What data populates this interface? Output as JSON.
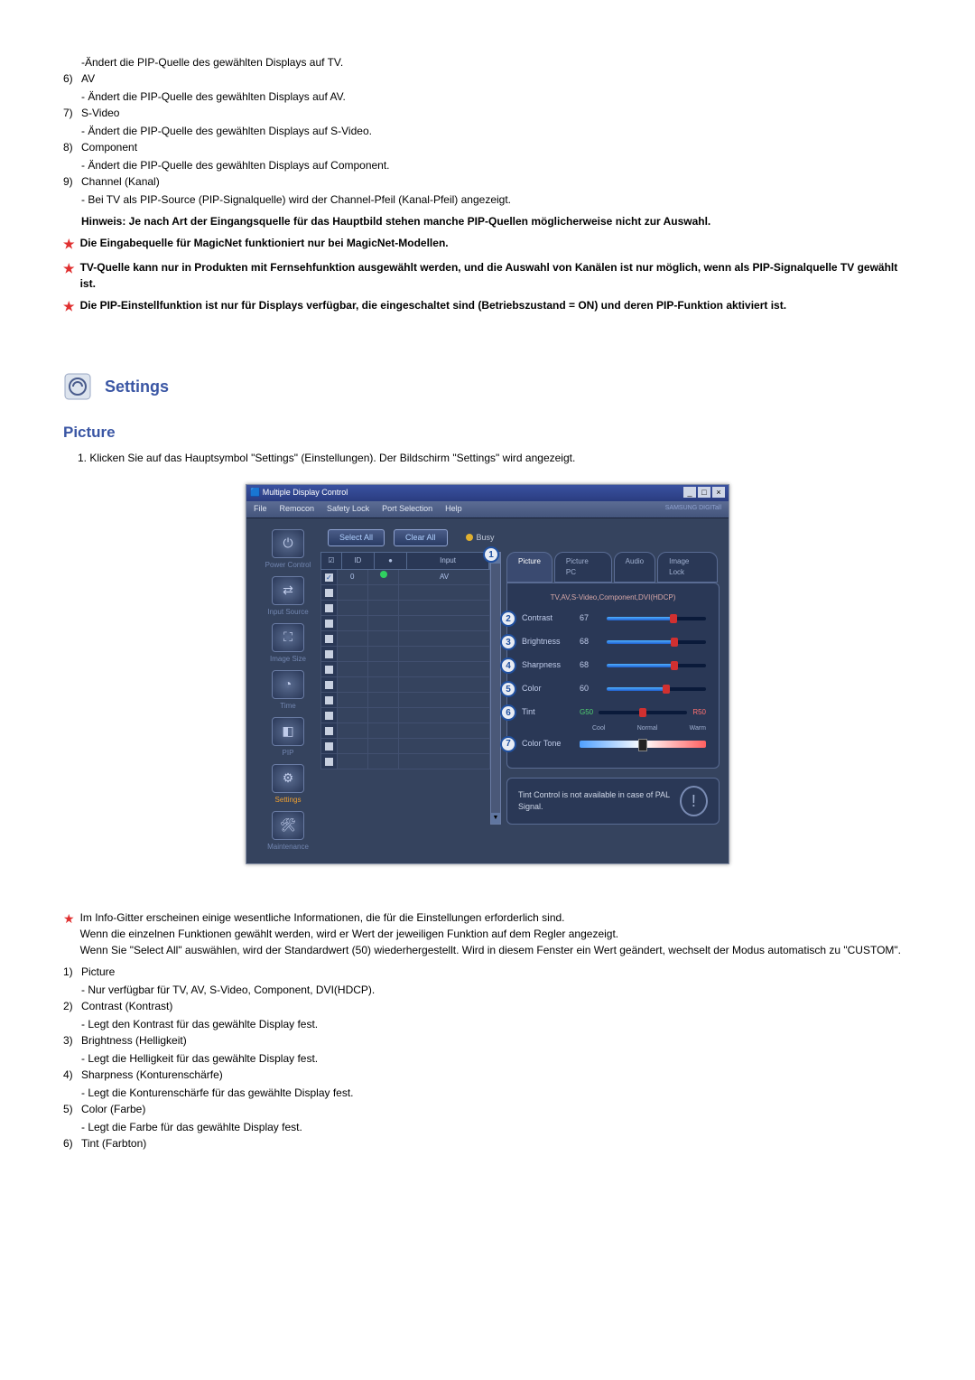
{
  "top_items": {
    "pip_tv_desc": "-Ändert die PIP-Quelle des gewählten Displays auf TV.",
    "n6": "6)",
    "n6_title": "AV",
    "n6_desc": "- Ändert die PIP-Quelle des gewählten Displays auf AV.",
    "n7": "7)",
    "n7_title": "S-Video",
    "n7_desc": "- Ändert die PIP-Quelle des gewählten Displays auf S-Video.",
    "n8": "8)",
    "n8_title": "Component",
    "n8_desc": "- Ändert die PIP-Quelle des gewählten Displays auf Component.",
    "n9": "9)",
    "n9_title": "Channel (Kanal)",
    "n9_desc": "- Bei TV als PIP-Source (PIP-Signalquelle) wird der Channel-Pfeil (Kanal-Pfeil) angezeigt.",
    "bold_note": "Hinweis: Je nach Art der Eingangsquelle für das Hauptbild stehen manche PIP-Quellen möglicherweise nicht zur Auswahl.",
    "star1": "Die Eingabequelle für MagicNet funktioniert nur bei MagicNet-Modellen.",
    "star2": "TV-Quelle kann nur in Produkten mit Fernsehfunktion ausgewählt werden, und die Auswahl von Kanälen ist nur möglich, wenn als PIP-Signalquelle TV gewählt ist.",
    "star3": "Die PIP-Einstellfunktion ist nur für Displays verfügbar, die eingeschaltet sind (Betriebszustand = ON) und deren PIP-Funktion aktiviert ist."
  },
  "settings_title": "Settings",
  "picture_title": "Picture",
  "picture_intro": "1.  Klicken Sie auf das Hauptsymbol \"Settings\" (Einstellungen). Der Bildschirm \"Settings\" wird angezeigt.",
  "app": {
    "window_title": "Multiple Display Control",
    "menu": {
      "file": "File",
      "remocon": "Remocon",
      "safety": "Safety Lock",
      "port": "Port Selection",
      "help": "Help"
    },
    "brand": "SAMSUNG DIGITall",
    "sidebar": {
      "power": "Power Control",
      "input": "Input Source",
      "image": "Image Size",
      "time": "Time",
      "pip": "PIP",
      "settings": "Settings",
      "maint": "Maintenance"
    },
    "buttons": {
      "select_all": "Select All",
      "clear_all": "Clear All",
      "busy": "Busy"
    },
    "grid": {
      "h_chk": "☑",
      "h_id": "ID",
      "h_on": "",
      "h_input": "Input",
      "rows": [
        {
          "id": "0",
          "input": "AV",
          "checked": true,
          "on": true
        }
      ],
      "empty_rows": 12
    },
    "panel": {
      "tabs": {
        "picture": "Picture",
        "picture_pc": "Picture PC",
        "audio": "Audio",
        "image_lock": "Image Lock"
      },
      "subtitle": "TV,AV,S-Video,Component,DVI(HDCP)",
      "contrast": "Contrast",
      "contrast_v": "67",
      "brightness": "Brightness",
      "brightness_v": "68",
      "sharpness": "Sharpness",
      "sharpness_v": "68",
      "color": "Color",
      "color_v": "60",
      "tint": "Tint",
      "tint_l": "G50",
      "tint_r": "R50",
      "colortone": "Color Tone",
      "tone_cool": "Cool",
      "tone_normal": "Normal",
      "tone_warm": "Warm"
    },
    "status": "Tint Control is not available in case of PAL Signal."
  },
  "bottom": {
    "star_intro": "Im Info-Gitter erscheinen einige wesentliche Informationen, die für die Einstellungen erforderlich sind.",
    "star_line2": "Wenn die einzelnen Funktionen gewählt werden, wird er Wert der jeweiligen Funktion auf dem Regler angezeigt.",
    "star_line3": "Wenn Sie \"Select All\" auswählen, wird der Standardwert (50) wiederhergestellt. Wird in diesem Fenster ein Wert geändert, wechselt der Modus automatisch zu \"CUSTOM\".",
    "n1": "1)",
    "n1_t": "Picture",
    "n1_d": "- Nur verfügbar für TV, AV, S-Video, Component, DVI(HDCP).",
    "n2": "2)",
    "n2_t": "Contrast (Kontrast)",
    "n2_d": "- Legt den Kontrast für das gewählte Display fest.",
    "n3": "3)",
    "n3_t": "Brightness (Helligkeit)",
    "n3_d": "- Legt die Helligkeit für das gewählte Display fest.",
    "n4": "4)",
    "n4_t": "Sharpness (Konturenschärfe)",
    "n4_d": "- Legt die Konturenschärfe für das gewählte Display fest.",
    "n5": "5)",
    "n5_t": "Color (Farbe)",
    "n5_d": "- Legt die Farbe für das gewählte Display fest.",
    "n6": "6)",
    "n6_t": "Tint (Farbton)"
  }
}
